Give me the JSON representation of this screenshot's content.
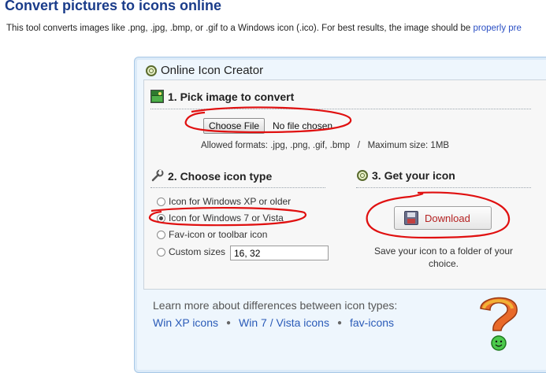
{
  "page": {
    "title": "Convert pictures to icons online",
    "intro_text": "This tool converts images like .png, .jpg, .bmp, or .gif to a Windows icon (.ico). For best results, the image should be ",
    "intro_link": "properly pre"
  },
  "panel": {
    "title": "Online Icon Creator",
    "section1": {
      "title": "1. Pick image to convert",
      "choose_button": "Choose File",
      "file_status": "No file chosen",
      "allowed": "Allowed formats: .jpg, .png, .gif, .bmp   /   Maximum size: 1MB"
    },
    "section2": {
      "title": "2. Choose icon type",
      "options": [
        "Icon for Windows XP or older",
        "Icon for Windows 7 or Vista",
        "Fav-icon or toolbar icon",
        "Custom sizes"
      ],
      "selected_index": 1,
      "custom_sizes_value": "16, 32"
    },
    "section3": {
      "title": "3. Get your icon",
      "download_label": "Download",
      "save_text": "Save your icon to a folder of your choice."
    },
    "footer": {
      "learn_more": "Learn more about differences between icon types:",
      "links": [
        "Win XP icons",
        "Win 7 / Vista icons",
        "fav-icons"
      ]
    }
  },
  "colors": {
    "title_blue": "#1a3c8a",
    "link_blue": "#2a5bb8",
    "download_red": "#b52222",
    "annotation_red": "#e01010"
  }
}
